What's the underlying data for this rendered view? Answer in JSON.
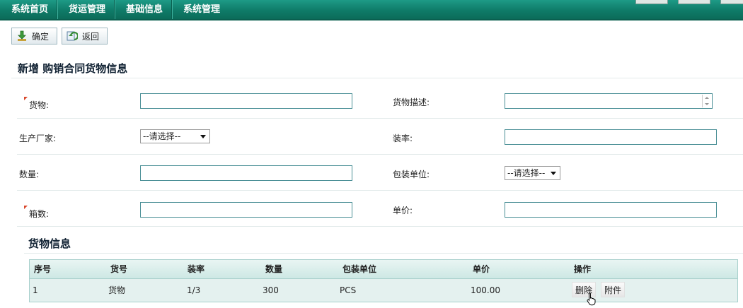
{
  "nav": [
    "系统首页",
    "货运管理",
    "基础信息",
    "系统管理"
  ],
  "toolbar": {
    "confirm_label": "确定",
    "back_label": "返回"
  },
  "page_title": "新增 购销合同货物信息",
  "form": {
    "goods_label": "货物:",
    "goods_desc_label": "货物描述:",
    "factory_label": "生产厂家:",
    "factory_value": "--请选择--",
    "rate_label": "装率:",
    "quantity_label": "数量:",
    "pack_unit_label": "包装单位:",
    "pack_unit_value": "--请选择--",
    "boxes_label": "箱数:",
    "price_label": "单价:"
  },
  "section_title": "货物信息",
  "table": {
    "headers": [
      "序号",
      "货号",
      "装率",
      "数量",
      "包装单位",
      "单价",
      "操作"
    ],
    "rows": [
      {
        "no": "1",
        "item": "货物",
        "rate": "1/3",
        "qty": "300",
        "unit": "PCS",
        "price": "100.00",
        "delete_label": "删除",
        "attach_label": "附件"
      }
    ]
  },
  "colors": {
    "nav": "#0f7b68",
    "required_mark": "#d9472b",
    "table_header": "#cde8e4"
  }
}
